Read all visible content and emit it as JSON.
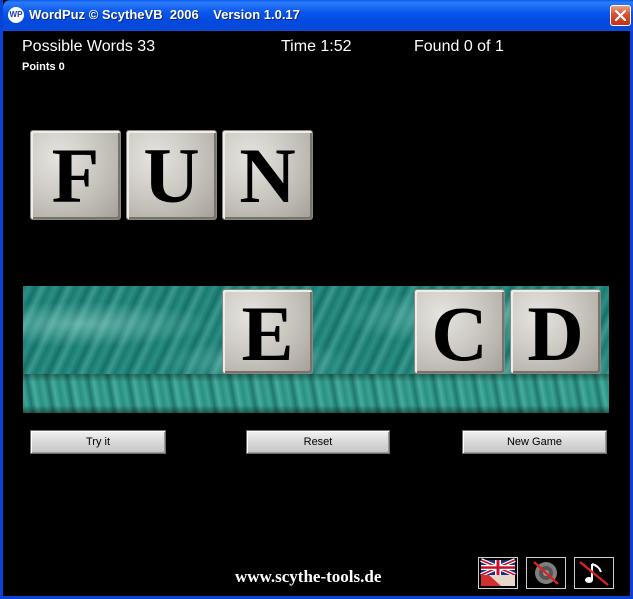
{
  "window": {
    "title": "WordPuz © ScytheVB  2006    Version 1.0.17",
    "app_icon_text": "WP"
  },
  "stats": {
    "possible_words": "Possible Words 33",
    "time": "Time 1:52",
    "found": "Found 0 of 1",
    "points": "Points 0"
  },
  "word_tiles": [
    "F",
    "U",
    "N"
  ],
  "tray_tiles": [
    {
      "letter": "E"
    },
    {
      "letter": "C"
    },
    {
      "letter": "D"
    }
  ],
  "buttons": {
    "try_it": "Try it",
    "reset": "Reset",
    "new_game": "New Game"
  },
  "footer": {
    "website": "www.scythe-tools.de"
  },
  "colors": {
    "titlebar": "#0a56ec",
    "background": "#000000",
    "tile": "#cfccc6",
    "water": "#1a7a70"
  }
}
